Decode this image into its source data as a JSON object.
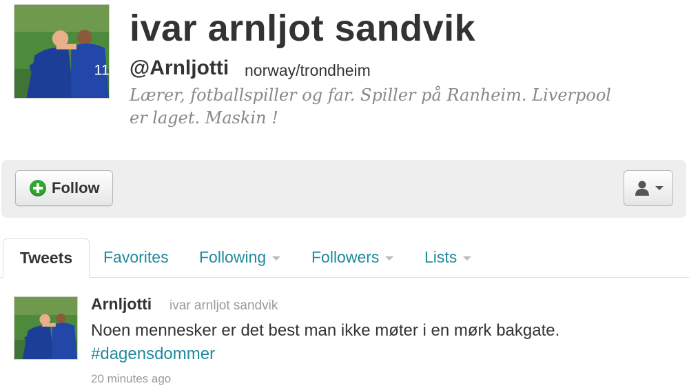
{
  "profile": {
    "name": "ivar arnljot sandvik",
    "screen_name": "@Arnljotti",
    "location": "norway/trondheim",
    "bio": "Lærer, fotballspiller og far. Spiller på Ranheim. Liverpool er laget. Maskin !"
  },
  "actions": {
    "follow_label": "Follow",
    "user_menu_icon": "person-icon"
  },
  "tabs": [
    {
      "label": "Tweets",
      "active": true
    },
    {
      "label": "Favorites"
    },
    {
      "label": "Following",
      "dropdown": true
    },
    {
      "label": "Followers",
      "dropdown": true
    },
    {
      "label": "Lists",
      "dropdown": true
    }
  ],
  "tweet": {
    "screen_name": "Arnljotti",
    "full_name": "ivar arnljot sandvik",
    "text": "Noen mennesker er det best man ikke møter i en mørk bakgate.",
    "hashtag": "#dagensdommer",
    "timestamp": "20 minutes ago"
  },
  "colors": {
    "link": "#1e8a9c",
    "text": "#333333",
    "muted": "#999999",
    "follow_plus": "#2fa82e"
  }
}
